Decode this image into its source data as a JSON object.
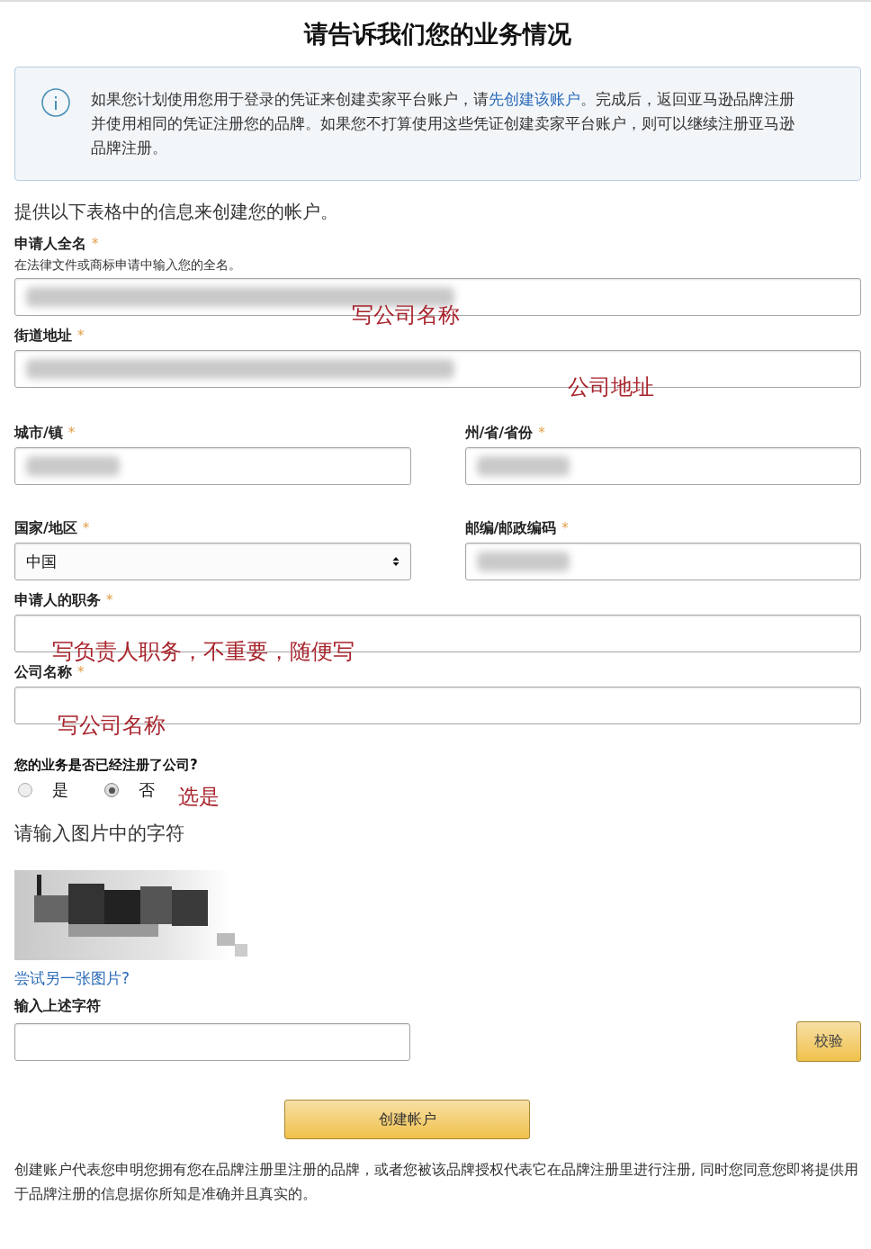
{
  "title": "请告诉我们您的业务情况",
  "notice": {
    "text_before": "如果您计划使用您用于登录的凭证来创建卖家平台账户，请",
    "link": "先创建该账户",
    "text_after": "。完成后，返回亚马逊品牌注册并使用相同的凭证注册您的品牌。如果您不打算使用这些凭证创建卖家平台账户，则可以继续注册亚马逊品牌注册。"
  },
  "intro": "提供以下表格中的信息来创建您的帐户。",
  "rows": [
    {
      "fields": [
        {
          "kind": "text",
          "label": "申请人全名",
          "required": "*",
          "hint": "在法律文件或商标申请中输入您的全名。",
          "redacted": true,
          "annotation": "写公司名称"
        }
      ]
    },
    {
      "fields": [
        {
          "kind": "text",
          "label": "街道地址",
          "required": "*",
          "redacted": true,
          "annotation": "公司地址"
        }
      ]
    },
    {
      "fields": [
        {
          "kind": "text",
          "label": "城市/镇",
          "required": "*",
          "redacted": true
        },
        {
          "kind": "text",
          "label": "州/省/省份",
          "required": "*",
          "redacted": true
        }
      ]
    },
    {
      "fields": [
        {
          "kind": "select",
          "label": "国家/地区",
          "required": "*",
          "value": "中国"
        },
        {
          "kind": "text",
          "label": "邮编/邮政编码",
          "required": "*",
          "redacted": true
        }
      ]
    },
    {
      "fields": [
        {
          "kind": "text",
          "label": "申请人的职务",
          "required": "*",
          "redacted": false,
          "annotation": "写负责人职务，不重要，随便写"
        }
      ]
    },
    {
      "fields": [
        {
          "kind": "text",
          "label": "公司名称",
          "required": "*",
          "redacted": false,
          "annotation": "写公司名称"
        }
      ]
    }
  ],
  "question": {
    "label": "您的业务是否已经注册了公司?",
    "options": [
      {
        "label": "是",
        "selected": false
      },
      {
        "label": "否",
        "selected": true
      }
    ],
    "annotation": "选是"
  },
  "captcha": {
    "title": "请输入图片中的字符",
    "link": "尝试另一张图片?",
    "label": "输入上述字符",
    "verify_button": "校验"
  },
  "submit": "创建帐户",
  "footer": "创建账户代表您申明您拥有您在品牌注册里注册的品牌，或者您被该品牌授权代表它在品牌注册里进行注册, 同时您同意您即将提供用于品牌注册的信息据你所知是准确并且真实的。"
}
